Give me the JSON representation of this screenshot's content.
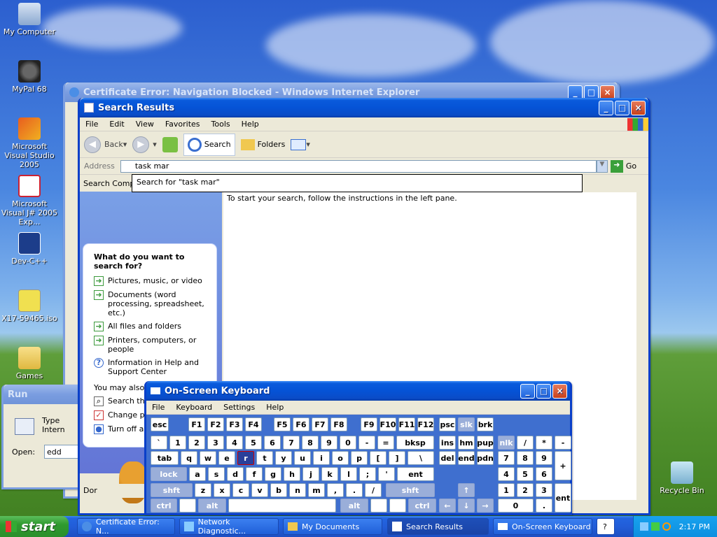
{
  "desktop": {
    "icons": [
      {
        "label": "My Computer"
      },
      {
        "label": "MyPal 68"
      },
      {
        "label": "Microsoft Visual Studio 2005"
      },
      {
        "label": "Microsoft Visual J# 2005 Exp..."
      },
      {
        "label": "Dev-C++"
      },
      {
        "label": "X17-59465.iso"
      },
      {
        "label": "Games"
      },
      {
        "label": "Recycle Bin"
      }
    ]
  },
  "ie_window": {
    "title": "Certificate Error: Navigation Blocked - Windows Internet Explorer"
  },
  "search_window": {
    "title": "Search Results",
    "menu": [
      "File",
      "Edit",
      "View",
      "Favorites",
      "Tools",
      "Help"
    ],
    "toolbar": {
      "back": "Back",
      "search": "Search",
      "folders": "Folders"
    },
    "address_label": "Address",
    "address_value": "task mar",
    "go_label": "Go",
    "autocomplete": "Search for \"task mar\"",
    "search_companion": "Search Compa",
    "right_pane_text": "To start your search, follow the instructions in the left pane.",
    "panel": {
      "heading": "What do you want to search for?",
      "items": [
        "Pictures, music, or video",
        "Documents (word processing, spreadsheet, etc.)",
        "All files and folders",
        "Printers, computers, or people",
        "Information in Help and Support Center"
      ],
      "also_label": "You may also w",
      "also_items": [
        "Search the",
        "Change pre",
        "Turn off an"
      ]
    },
    "status_text": "Dor"
  },
  "run_window": {
    "title": "Run",
    "type_text": "Type",
    "intern_text": "Intern",
    "open_label": "Open:",
    "open_value": "edd"
  },
  "osk": {
    "title": "On-Screen Keyboard",
    "menu": [
      "File",
      "Keyboard",
      "Settings",
      "Help"
    ],
    "rows": {
      "fn": [
        "esc",
        "F1",
        "F2",
        "F3",
        "F4",
        "F5",
        "F6",
        "F7",
        "F8",
        "F9",
        "F10",
        "F11",
        "F12",
        "psc",
        "slk",
        "brk"
      ],
      "num": [
        "`",
        "1",
        "2",
        "3",
        "4",
        "5",
        "6",
        "7",
        "8",
        "9",
        "0",
        "-",
        "=",
        "bksp",
        "ins",
        "hm",
        "pup",
        "nlk",
        "/",
        "*",
        "-"
      ],
      "top": [
        "tab",
        "q",
        "w",
        "e",
        "r",
        "t",
        "y",
        "u",
        "i",
        "o",
        "p",
        "[",
        "]",
        "\\",
        "del",
        "end",
        "pdn",
        "7",
        "8",
        "9",
        "+"
      ],
      "home": [
        "lock",
        "a",
        "s",
        "d",
        "f",
        "g",
        "h",
        "j",
        "k",
        "l",
        ";",
        "'",
        "ent",
        "4",
        "5",
        "6"
      ],
      "bottom": [
        "shft",
        "z",
        "x",
        "c",
        "v",
        "b",
        "n",
        "m",
        ",",
        ".",
        "/",
        "shft",
        "↑",
        "1",
        "2",
        "3",
        "ent"
      ],
      "space": [
        "ctrl",
        "",
        "alt",
        "",
        "alt",
        "",
        "",
        "ctrl",
        "←",
        "↓",
        "→",
        "0",
        "."
      ]
    }
  },
  "taskbar": {
    "start": "start",
    "buttons": [
      "Certificate Error: N...",
      "Network Diagnostic...",
      "My Documents",
      "Search Results",
      "On-Screen Keyboard"
    ],
    "clock": "2:17 PM"
  }
}
